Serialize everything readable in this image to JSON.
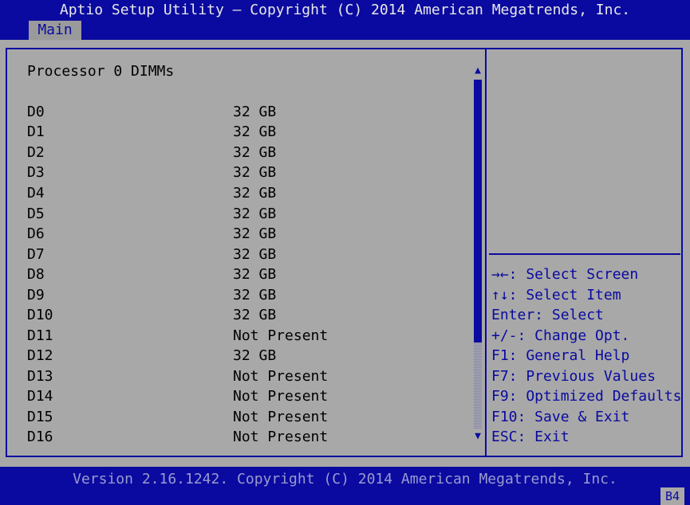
{
  "header": {
    "title": "Aptio Setup Utility – Copyright (C) 2014 American Megatrends, Inc.",
    "tab": "Main"
  },
  "main": {
    "section_title": "Processor 0 DIMMs",
    "dimms": [
      {
        "label": "D0",
        "value": "32 GB"
      },
      {
        "label": "D1",
        "value": "32 GB"
      },
      {
        "label": "D2",
        "value": "32 GB"
      },
      {
        "label": "D3",
        "value": "32 GB"
      },
      {
        "label": "D4",
        "value": "32 GB"
      },
      {
        "label": "D5",
        "value": "32 GB"
      },
      {
        "label": "D6",
        "value": "32 GB"
      },
      {
        "label": "D7",
        "value": "32 GB"
      },
      {
        "label": "D8",
        "value": "32 GB"
      },
      {
        "label": "D9",
        "value": "32 GB"
      },
      {
        "label": "D10",
        "value": "32 GB"
      },
      {
        "label": "D11",
        "value": "Not Present"
      },
      {
        "label": "D12",
        "value": "32 GB"
      },
      {
        "label": "D13",
        "value": "Not Present"
      },
      {
        "label": "D14",
        "value": "Not Present"
      },
      {
        "label": "D15",
        "value": "Not Present"
      },
      {
        "label": "D16",
        "value": "Not Present"
      }
    ]
  },
  "help": [
    "→←: Select Screen",
    "↑↓: Select Item",
    "Enter: Select",
    "+/-: Change Opt.",
    "F1: General Help",
    "F7: Previous Values",
    "F9: Optimized Defaults",
    "F10: Save & Exit",
    "ESC: Exit"
  ],
  "footer": {
    "version": "Version 2.16.1242. Copyright (C) 2014 American Megatrends, Inc.",
    "corner_code": "B4"
  },
  "icons": {
    "scroll_up": "scroll-up-arrow-icon",
    "scroll_down": "scroll-down-arrow-icon"
  },
  "colors": {
    "background_blue": "#0a0aa0",
    "panel_gray": "#a8a8a8",
    "tab_gray": "#9a9a9a"
  }
}
